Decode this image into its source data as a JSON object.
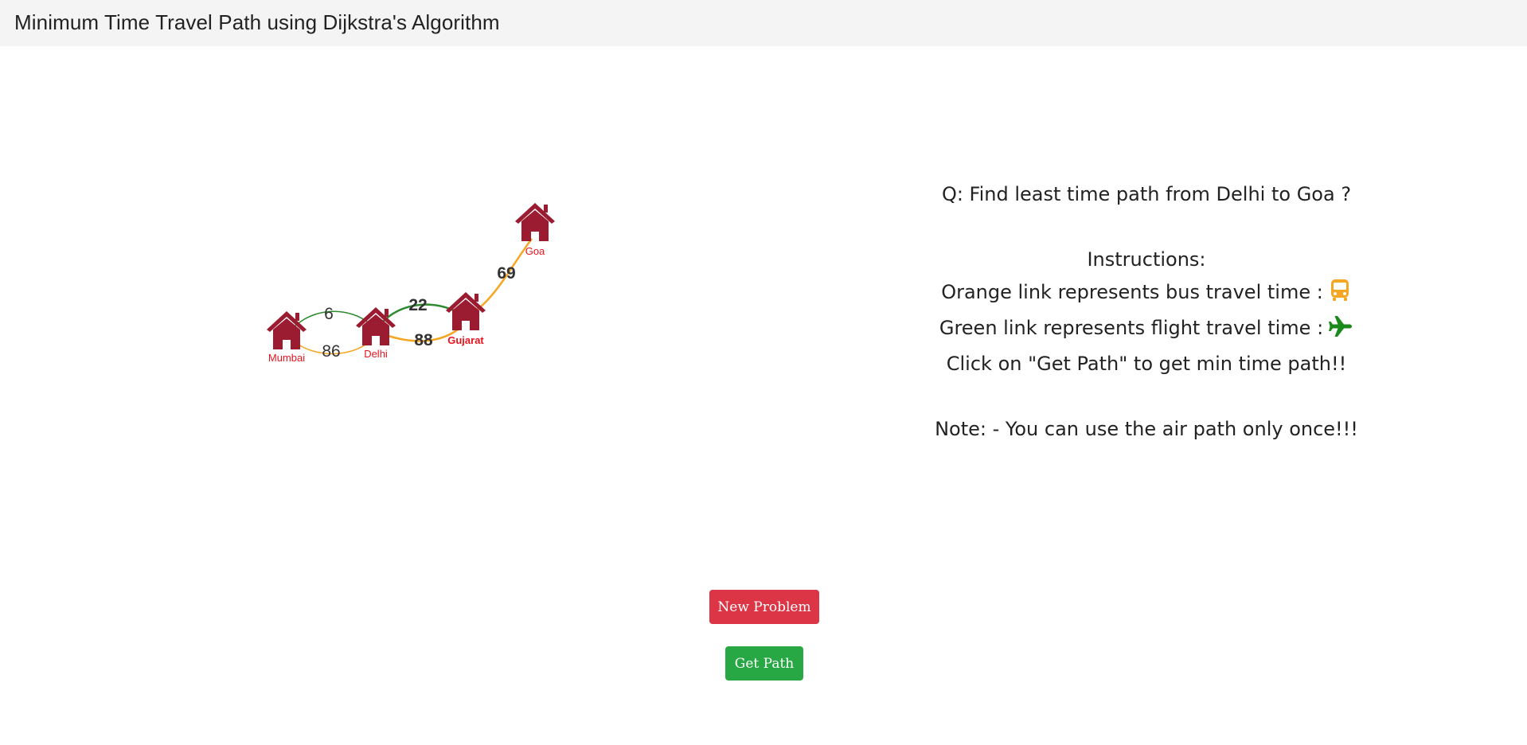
{
  "header": {
    "title": "Minimum Time Travel Path using Dijkstra's Algorithm"
  },
  "graph": {
    "nodes": [
      {
        "id": "mumbai",
        "label": "Mumbai"
      },
      {
        "id": "delhi",
        "label": "Delhi"
      },
      {
        "id": "gujarat",
        "label": "Gujarat"
      },
      {
        "id": "goa",
        "label": "Goa"
      }
    ],
    "edges": [
      {
        "from": "Mumbai",
        "to": "Delhi",
        "mode": "flight",
        "time": "6"
      },
      {
        "from": "Mumbai",
        "to": "Delhi",
        "mode": "bus",
        "time": "86"
      },
      {
        "from": "Delhi",
        "to": "Gujarat",
        "mode": "flight",
        "time": "22"
      },
      {
        "from": "Delhi",
        "to": "Gujarat",
        "mode": "bus",
        "time": "88"
      },
      {
        "from": "Gujarat",
        "to": "Goa",
        "mode": "bus",
        "time": "69"
      }
    ],
    "colors": {
      "bus": "#f5a623",
      "flight": "#2e8b2e",
      "house": "#9b1b30",
      "label": "#e8141d"
    }
  },
  "panel": {
    "question": "Q: Find least time path from Delhi to Goa ?",
    "instructions_title": "Instructions:",
    "bus_line": "Orange link represents bus travel time :",
    "flight_line": "Green link represents flight travel time :",
    "click_line": "Click on \"Get Path\" to get min time path!!",
    "note": "Note: - You can use the air path only once!!!",
    "bus_icon": "bus-icon",
    "plane_icon": "plane-icon"
  },
  "buttons": {
    "new_problem": "New Problem",
    "get_path": "Get Path"
  }
}
